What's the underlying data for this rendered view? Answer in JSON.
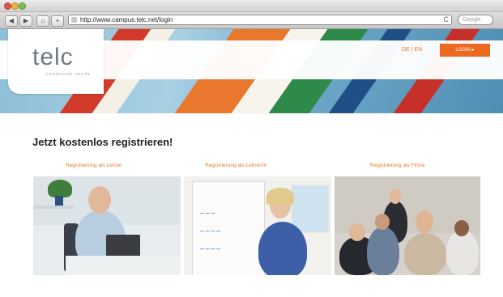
{
  "browser": {
    "url": "http://www.campus.telc.net/login",
    "reload_glyph": "C",
    "search_placeholder": "Google"
  },
  "site": {
    "logo": "telc",
    "logo_sub": "LANGUAGE TESTS",
    "language": "DE | EN",
    "login_button": "LOGIN ▸"
  },
  "main": {
    "heading": "Jetzt kostenlos registrieren!",
    "register_links": [
      {
        "label": "Registrierung als Lerner"
      },
      {
        "label": "Registrierung als Lehrer/in"
      },
      {
        "label": "Registrierung als Firma"
      }
    ]
  },
  "colors": {
    "accent_orange": "#ec6a1f",
    "logo_gray": "#6f7b80"
  },
  "icons": [
    "back-arrow-icon",
    "forward-arrow-icon",
    "home-icon",
    "bookmark-icon",
    "reload-icon"
  ]
}
